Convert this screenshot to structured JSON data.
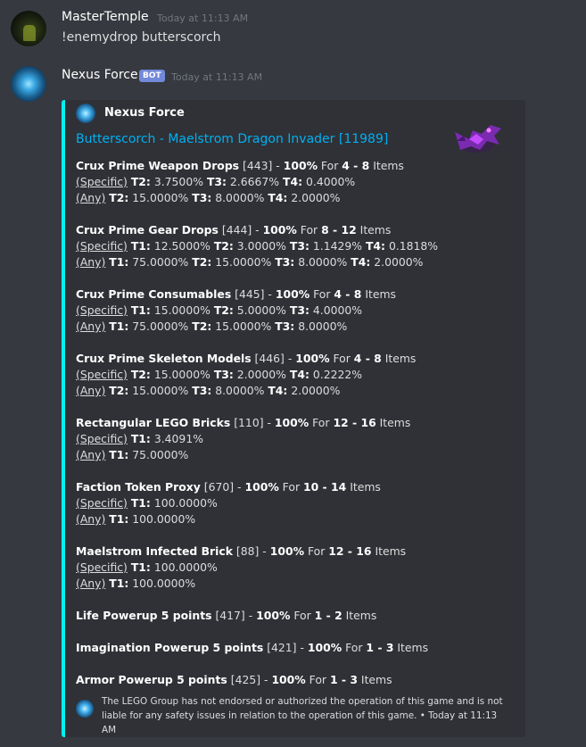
{
  "message1": {
    "author": "MasterTemple",
    "timestamp": "Today at 11:13 AM",
    "text": "!enemydrop butterscorch"
  },
  "message2": {
    "author": "Nexus Force",
    "badge": "BOT",
    "timestamp": "Today at 11:13 AM"
  },
  "embed": {
    "accent_color": "#00f0f0",
    "author": "Nexus Force",
    "title": "Butterscorch - Maelstrom Dragon Invader [11989]",
    "fields": [
      {
        "name": "Crux Prime Weapon Drops",
        "id": "[443]",
        "pct": "100%",
        "range": "4 - 8",
        "specific": [
          [
            "T2:",
            "3.7500%"
          ],
          [
            "T3:",
            "2.6667%"
          ],
          [
            "T4:",
            "0.4000%"
          ]
        ],
        "any": [
          [
            "T2:",
            "15.0000%"
          ],
          [
            "T3:",
            "8.0000%"
          ],
          [
            "T4:",
            "2.0000%"
          ]
        ]
      },
      {
        "name": "Crux Prime Gear Drops",
        "id": "[444]",
        "pct": "100%",
        "range": "8 - 12",
        "specific": [
          [
            "T1:",
            "12.5000%"
          ],
          [
            "T2:",
            "3.0000%"
          ],
          [
            "T3:",
            "1.1429%"
          ],
          [
            "T4:",
            "0.1818%"
          ]
        ],
        "any": [
          [
            "T1:",
            "75.0000%"
          ],
          [
            "T2:",
            "15.0000%"
          ],
          [
            "T3:",
            "8.0000%"
          ],
          [
            "T4:",
            "2.0000%"
          ]
        ]
      },
      {
        "name": "Crux Prime Consumables",
        "id": "[445]",
        "pct": "100%",
        "range": "4 - 8",
        "specific": [
          [
            "T1:",
            "15.0000%"
          ],
          [
            "T2:",
            "5.0000%"
          ],
          [
            "T3:",
            "4.0000%"
          ]
        ],
        "any": [
          [
            "T1:",
            "75.0000%"
          ],
          [
            "T2:",
            "15.0000%"
          ],
          [
            "T3:",
            "8.0000%"
          ]
        ]
      },
      {
        "name": "Crux Prime Skeleton Models",
        "id": "[446]",
        "pct": "100%",
        "range": "4 - 8",
        "specific": [
          [
            "T2:",
            "15.0000%"
          ],
          [
            "T3:",
            "2.0000%"
          ],
          [
            "T4:",
            "0.2222%"
          ]
        ],
        "any": [
          [
            "T2:",
            "15.0000%"
          ],
          [
            "T3:",
            "8.0000%"
          ],
          [
            "T4:",
            "2.0000%"
          ]
        ]
      },
      {
        "name": "Rectangular LEGO Bricks",
        "id": "[110]",
        "pct": "100%",
        "range": "12 - 16",
        "specific": [
          [
            "T1:",
            "3.4091%"
          ]
        ],
        "any": [
          [
            "T1:",
            "75.0000%"
          ]
        ]
      },
      {
        "name": "Faction Token Proxy",
        "id": "[670]",
        "pct": "100%",
        "range": "10 - 14",
        "specific": [
          [
            "T1:",
            "100.0000%"
          ]
        ],
        "any": [
          [
            "T1:",
            "100.0000%"
          ]
        ]
      },
      {
        "name": "Maelstrom Infected Brick",
        "id": "[88]",
        "pct": "100%",
        "range": "12 - 16",
        "specific": [
          [
            "T1:",
            "100.0000%"
          ]
        ],
        "any": [
          [
            "T1:",
            "100.0000%"
          ]
        ]
      },
      {
        "name": "Life Powerup 5 points",
        "id": "[417]",
        "pct": "100%",
        "range": "1 - 2",
        "specific": [],
        "any": []
      },
      {
        "name": "Imagination Powerup 5 points",
        "id": "[421]",
        "pct": "100%",
        "range": "1 - 3",
        "specific": [],
        "any": []
      },
      {
        "name": "Armor Powerup 5 points",
        "id": "[425]",
        "pct": "100%",
        "range": "1 - 3",
        "specific": [],
        "any": []
      }
    ],
    "labels": {
      "specific": "(Specific)",
      "any": "(Any)",
      "dash": "-",
      "for": "For",
      "items": "Items"
    },
    "footer": {
      "text_line1": "The LEGO Group has not endorsed or authorized the operation of this game and is not",
      "text_line2": "liable for any safety issues in relation to the operation of this game. • Today at 11:13 AM"
    }
  }
}
